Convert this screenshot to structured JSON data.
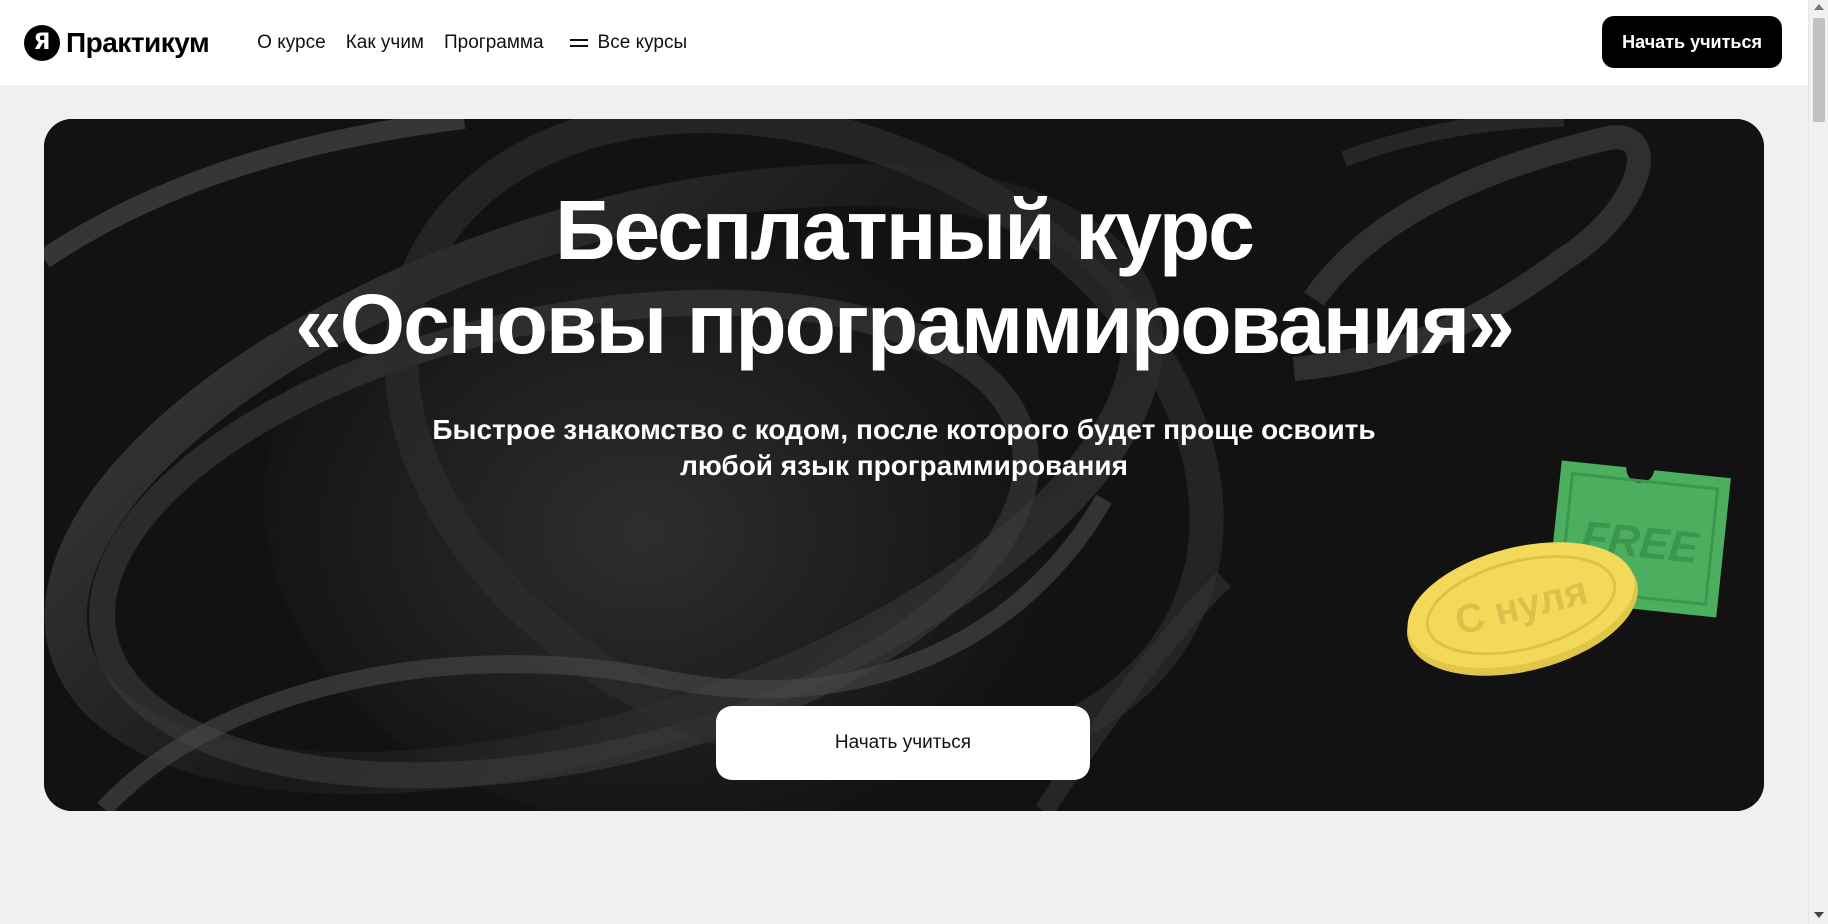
{
  "header": {
    "logo_mark": "Я",
    "logo_text": "Практикум",
    "nav": [
      {
        "label": "О курсе"
      },
      {
        "label": "Как учим"
      },
      {
        "label": "Программа"
      }
    ],
    "all_courses_label": "Все курсы",
    "cta_label": "Начать учиться"
  },
  "hero": {
    "title_line1": "Бесплатный курс",
    "title_line2": "«Основы программирования»",
    "subtitle_line1": "Быстрое знакомство с кодом, после которого будет проще освоить",
    "subtitle_line2": "любой язык программирования",
    "cta_label": "Начать учиться",
    "ticket_text": "FREE",
    "coin_text": "С нуля"
  },
  "colors": {
    "header_bg": "#ffffff",
    "page_bg": "#f0f0f0",
    "hero_bg": "#121212",
    "primary_button": "#000000",
    "ticket_green": "#4caf5f",
    "coin_yellow": "#f3d95a"
  }
}
